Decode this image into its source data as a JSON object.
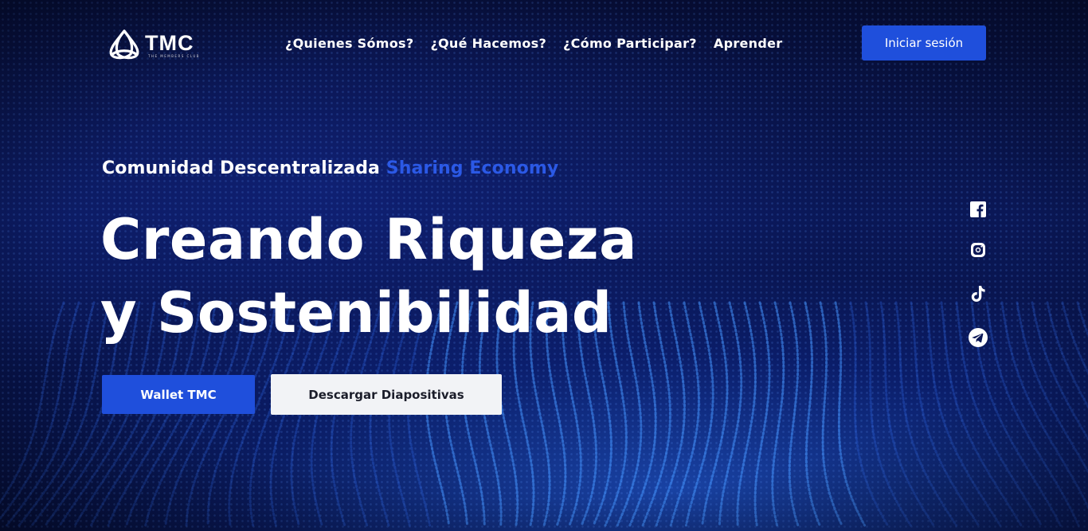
{
  "brand": {
    "name": "TMC",
    "subtitle": "THE MEMBERS CLUB"
  },
  "nav": {
    "items": [
      {
        "label": "¿Quienes Sómos?"
      },
      {
        "label": "¿Qué Hacemos?"
      },
      {
        "label": "¿Cómo Participar?"
      },
      {
        "label": "Aprender"
      }
    ],
    "login_label": "Iniciar sesión"
  },
  "hero": {
    "tagline_main": "Comunidad Descentralizada",
    "tagline_accent": "Sharing Economy",
    "headline_line1": "Creando Riqueza",
    "headline_line2": "y Sostenibilidad",
    "primary_button": "Wallet TMC",
    "secondary_button": "Descargar Diapositivas"
  },
  "social": [
    {
      "icon": "facebook-icon"
    },
    {
      "icon": "instagram-icon"
    },
    {
      "icon": "tiktok-icon"
    },
    {
      "icon": "telegram-icon"
    }
  ],
  "colors": {
    "accent": "#1f4fdc",
    "accent_text": "#2b59e6",
    "background": "#0a1756",
    "secondary_button_bg": "#f2f3f6"
  }
}
